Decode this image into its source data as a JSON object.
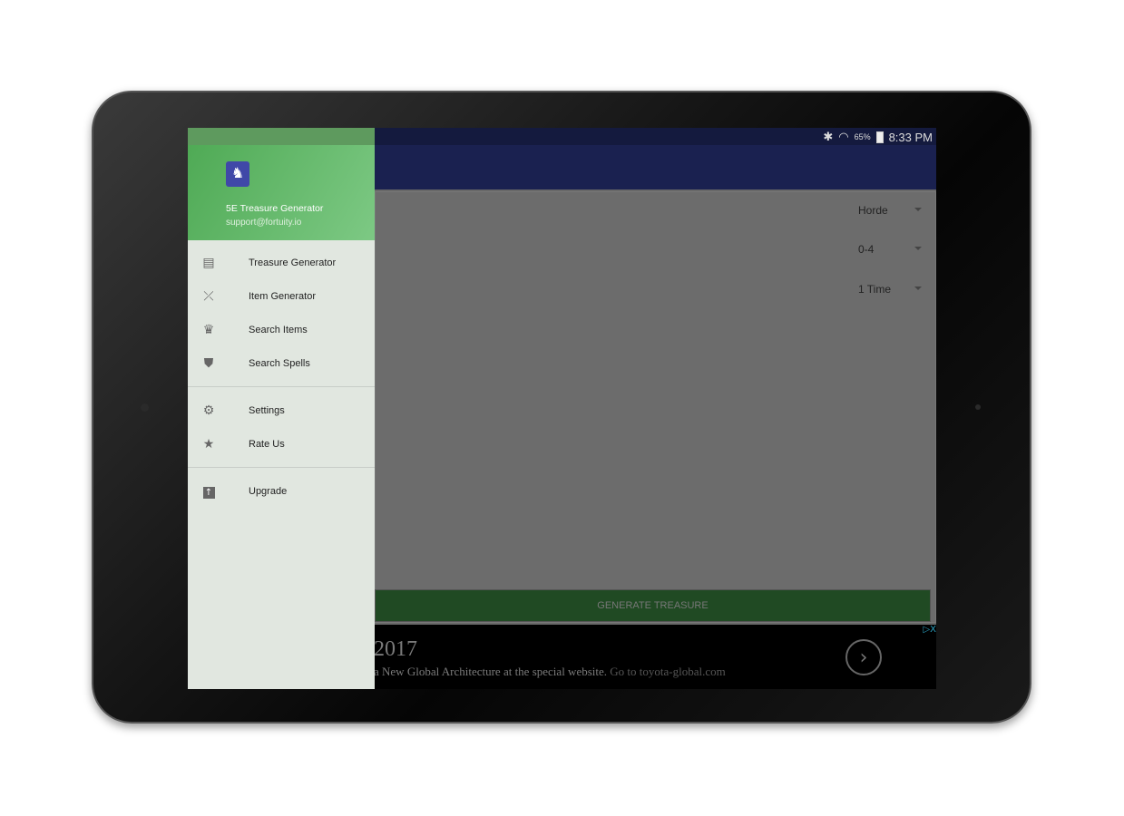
{
  "status_bar": {
    "battery": "65%",
    "time": "8:33 PM",
    "icons": [
      "bluetooth-icon",
      "wifi-icon",
      "battery-icon"
    ]
  },
  "drawer": {
    "app_name": "5E Treasure Generator",
    "email": "support@fortuity.io",
    "sections": [
      [
        {
          "label": "Treasure Generator",
          "icon": "chest-icon"
        },
        {
          "label": "Item Generator",
          "icon": "bow-icon"
        },
        {
          "label": "Search Items",
          "icon": "crown-icon"
        },
        {
          "label": "Search Spells",
          "icon": "shield-icon"
        }
      ],
      [
        {
          "label": "Settings",
          "icon": "gear-icon"
        },
        {
          "label": "Rate Us",
          "icon": "star-icon"
        }
      ],
      [
        {
          "label": "Upgrade",
          "icon": "upgrade-icon"
        }
      ]
    ]
  },
  "main": {
    "dropdowns": [
      "Horde",
      "0-4",
      "1 Time"
    ],
    "generate_label": "GENERATE TREASURE"
  },
  "ad": {
    "headline": "2017",
    "text": "a New Global Architecture at the special website.",
    "link": "Go to toyota-global.com",
    "close": "▷X"
  },
  "colors": {
    "toolbar": "#1a2150",
    "drawer_header": "#66b86c",
    "button": "#204a23"
  }
}
